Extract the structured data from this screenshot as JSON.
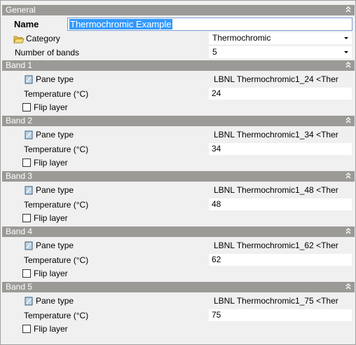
{
  "general": {
    "header": "General",
    "name_label": "Name",
    "name_value": "Thermochromic Example",
    "category_label": "Category",
    "category_value": "Thermochromic",
    "bands_label": "Number of bands",
    "bands_value": "5"
  },
  "labels": {
    "pane_type": "Pane type",
    "temperature": "Temperature (°C)",
    "flip_layer": "Flip layer"
  },
  "bands": [
    {
      "header": "Band 1",
      "pane_type": "LBNL Thermochromic1_24 <Ther",
      "temperature": "24",
      "flip": false
    },
    {
      "header": "Band 2",
      "pane_type": "LBNL Thermochromic1_34 <Ther",
      "temperature": "34",
      "flip": false
    },
    {
      "header": "Band 3",
      "pane_type": "LBNL Thermochromic1_48 <Ther",
      "temperature": "48",
      "flip": false
    },
    {
      "header": "Band 4",
      "pane_type": "LBNL Thermochromic1_62 <Ther",
      "temperature": "62",
      "flip": false
    },
    {
      "header": "Band 5",
      "pane_type": "LBNL Thermochromic1_75 <Ther",
      "temperature": "75",
      "flip": false
    }
  ],
  "icons": {
    "collapse": "double-chevron-up-icon",
    "category": "folder-icon",
    "pane": "glass-pane-icon",
    "dropdown": "dropdown-arrow-icon"
  },
  "colors": {
    "header_bg": "#9c9a96",
    "selection": "#3399ff",
    "background": "#f0f0f0"
  }
}
